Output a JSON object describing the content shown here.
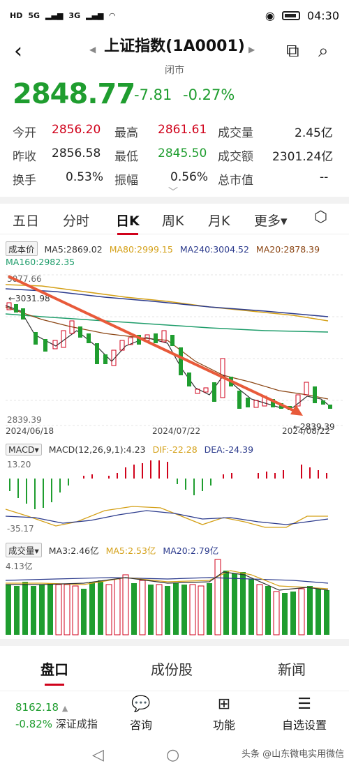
{
  "status": {
    "carrier1": "HD",
    "net1": "5G",
    "net2": "3G",
    "time": "04:30"
  },
  "header": {
    "title": "上证指数(1A0001)",
    "subtitle": "闭市"
  },
  "quote": {
    "price": "2848.77",
    "change": "-7.81",
    "change_pct": "-0.27%"
  },
  "stats": [
    {
      "label": "今开",
      "value": "2856.20"
    },
    {
      "label": "最高",
      "value": "2861.61"
    },
    {
      "label": "成交量",
      "value": "2.45亿"
    },
    {
      "label": "昨收",
      "value": "2856.58"
    },
    {
      "label": "最低",
      "value": "2845.50"
    },
    {
      "label": "成交额",
      "value": "2301.24亿"
    },
    {
      "label": "换手",
      "value": "0.53%"
    },
    {
      "label": "振幅",
      "value": "0.56%"
    },
    {
      "label": "总市值",
      "value": "--"
    }
  ],
  "tabs": [
    "五日",
    "分时",
    "日K",
    "周K",
    "月K",
    "更多▾"
  ],
  "main_chart": {
    "indicator_label": "成本价",
    "ma5": "MA5:2869.02",
    "ma80": "MA80:2999.15",
    "ma240": "MA240:3004.52",
    "ma20": "MA20:2878.39",
    "ma160": "MA160:2982.35",
    "y_top": "3077.66",
    "y_bottom": "2839.39",
    "high_marker": "←3031.98",
    "low_marker": "←2839.39",
    "dates": [
      "2024/06/18",
      "2024/07/22",
      "2024/08/22"
    ]
  },
  "macd": {
    "label": "MACD▾",
    "params": "MACD(12,26,9,1):4.23",
    "dif": "DIF:-22.28",
    "dea": "DEA:-24.39",
    "y_top": "13.20",
    "y_bottom": "-35.17"
  },
  "volume": {
    "label": "成交量▾",
    "ma3": "MA3:2.46亿",
    "ma5": "MA5:2.53亿",
    "ma20": "MA20:2.79亿",
    "y_top": "4.13亿"
  },
  "bottom_tabs": [
    "盘口",
    "成份股",
    "新闻"
  ],
  "bottom_nav": {
    "index_value": "8162.18",
    "index_change": "-0.82%",
    "index_name": "深证成指",
    "items": [
      "咨询",
      "功能",
      "自选设置"
    ]
  },
  "watermark": "头条 @山东微电实用微信",
  "colors": {
    "up": "#d0021b",
    "down": "#1f9d2f",
    "accent": "#d0021b"
  }
}
